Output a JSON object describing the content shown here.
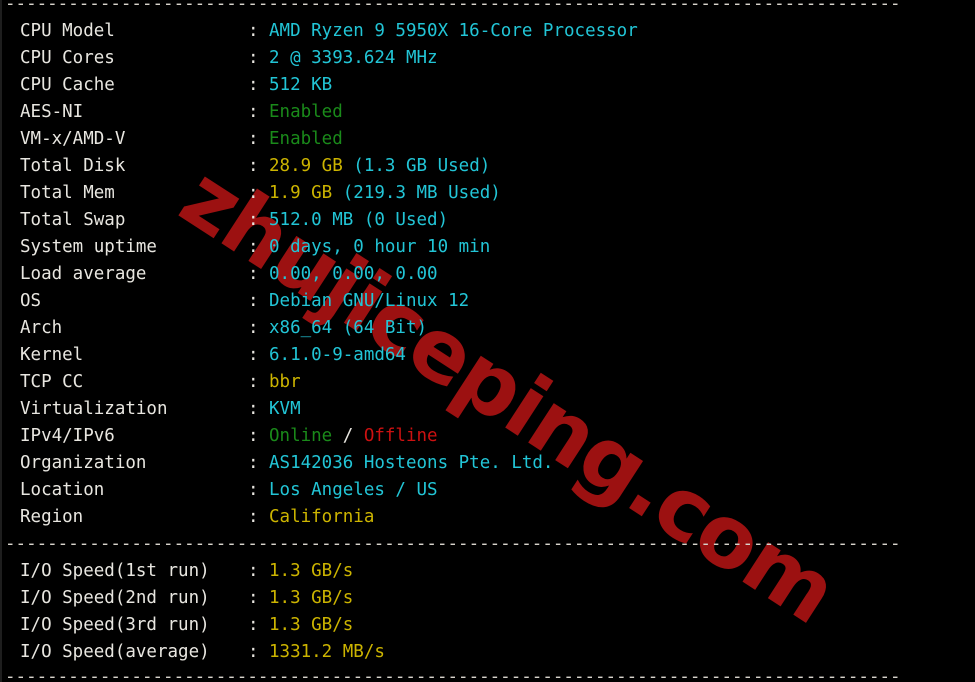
{
  "terminal": {
    "separator": "-------------------------------------------------------------------------------------",
    "separator_top": "-------------------------------------------------------------------------------------",
    "separator_mid": "-------------------------------------------------------------------------------------",
    "separator_bottom": "-------------------------------------------------------------------------------------",
    "colon": ":",
    "watermark": "zhujiceping.com",
    "colors": {
      "background": "#000000",
      "label": "#e8e6e0",
      "cyan": "#22c5d6",
      "yellow": "#ccb400",
      "green": "#1a8a1a",
      "red": "#cc1111",
      "watermark": "#9c1111"
    }
  },
  "system_info": [
    {
      "label": "CPU Model",
      "parts": [
        {
          "text": "AMD Ryzen 9 5950X 16-Core Processor",
          "color": "cyan"
        }
      ]
    },
    {
      "label": "CPU Cores",
      "parts": [
        {
          "text": "2 @ 3393.624 MHz",
          "color": "cyan"
        }
      ]
    },
    {
      "label": "CPU Cache",
      "parts": [
        {
          "text": "512 KB",
          "color": "cyan"
        }
      ]
    },
    {
      "label": "AES-NI",
      "parts": [
        {
          "text": "Enabled",
          "color": "green"
        }
      ]
    },
    {
      "label": "VM-x/AMD-V",
      "parts": [
        {
          "text": "Enabled",
          "color": "green"
        }
      ]
    },
    {
      "label": "Total Disk",
      "parts": [
        {
          "text": "28.9 GB ",
          "color": "yellow"
        },
        {
          "text": "(1.3 GB Used)",
          "color": "cyan"
        }
      ]
    },
    {
      "label": "Total Mem",
      "parts": [
        {
          "text": "1.9 GB ",
          "color": "yellow"
        },
        {
          "text": "(219.3 MB Used)",
          "color": "cyan"
        }
      ]
    },
    {
      "label": "Total Swap",
      "parts": [
        {
          "text": "512.0 MB (0 Used)",
          "color": "cyan"
        }
      ]
    },
    {
      "label": "System uptime",
      "parts": [
        {
          "text": "0 days, 0 hour 10 min",
          "color": "cyan"
        }
      ]
    },
    {
      "label": "Load average",
      "parts": [
        {
          "text": "0.00, 0.00, 0.00",
          "color": "cyan"
        }
      ]
    },
    {
      "label": "OS",
      "parts": [
        {
          "text": "Debian GNU/Linux 12",
          "color": "cyan"
        }
      ]
    },
    {
      "label": "Arch",
      "parts": [
        {
          "text": "x86_64 (64 Bit)",
          "color": "cyan"
        }
      ]
    },
    {
      "label": "Kernel",
      "parts": [
        {
          "text": "6.1.0-9-amd64",
          "color": "cyan"
        }
      ]
    },
    {
      "label": "TCP CC",
      "parts": [
        {
          "text": "bbr",
          "color": "yellow"
        }
      ]
    },
    {
      "label": "Virtualization",
      "parts": [
        {
          "text": "KVM",
          "color": "cyan"
        }
      ]
    },
    {
      "label": "IPv4/IPv6",
      "parts": [
        {
          "text": "Online",
          "color": "green"
        },
        {
          "text": " / ",
          "color": "white"
        },
        {
          "text": "Offline",
          "color": "red"
        }
      ]
    },
    {
      "label": "Organization",
      "parts": [
        {
          "text": "AS142036 Hosteons Pte. Ltd.",
          "color": "cyan"
        }
      ]
    },
    {
      "label": "Location",
      "parts": [
        {
          "text": "Los Angeles / US",
          "color": "cyan"
        }
      ]
    },
    {
      "label": "Region",
      "parts": [
        {
          "text": "California",
          "color": "yellow"
        }
      ]
    }
  ],
  "io_speed": [
    {
      "label": "I/O Speed(1st run)",
      "parts": [
        {
          "text": "1.3 GB/s",
          "color": "yellow"
        }
      ]
    },
    {
      "label": "I/O Speed(2nd run)",
      "parts": [
        {
          "text": "1.3 GB/s",
          "color": "yellow"
        }
      ]
    },
    {
      "label": "I/O Speed(3rd run)",
      "parts": [
        {
          "text": "1.3 GB/s",
          "color": "yellow"
        }
      ]
    },
    {
      "label": "I/O Speed(average)",
      "parts": [
        {
          "text": "1331.2 MB/s",
          "color": "yellow"
        }
      ]
    }
  ]
}
